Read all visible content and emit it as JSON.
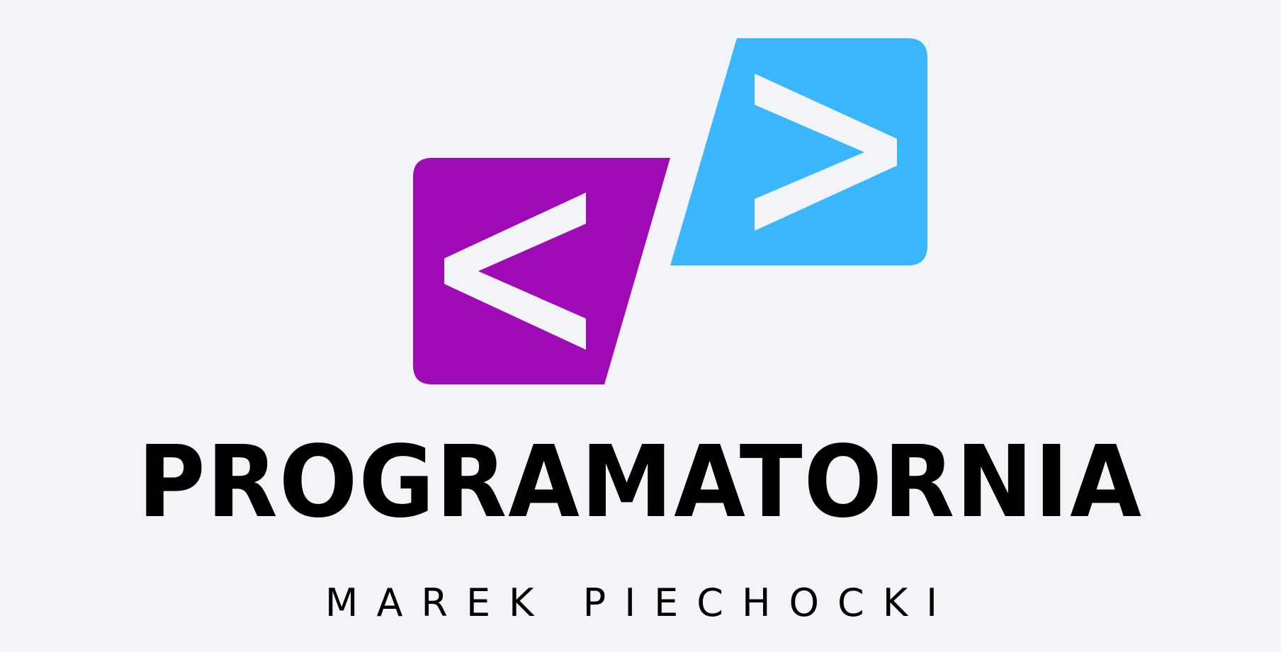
{
  "brand": {
    "name": "PROGRAMATORNIA",
    "author": "MAREK PIECHOCKI",
    "logo_icon": "code-brackets-icon",
    "colors": {
      "background": "#F2F4F8",
      "left_panel": "#9E0BB5",
      "right_panel": "#3AB6FE",
      "chevron": "#F2F4F8",
      "text": "#000000"
    }
  }
}
